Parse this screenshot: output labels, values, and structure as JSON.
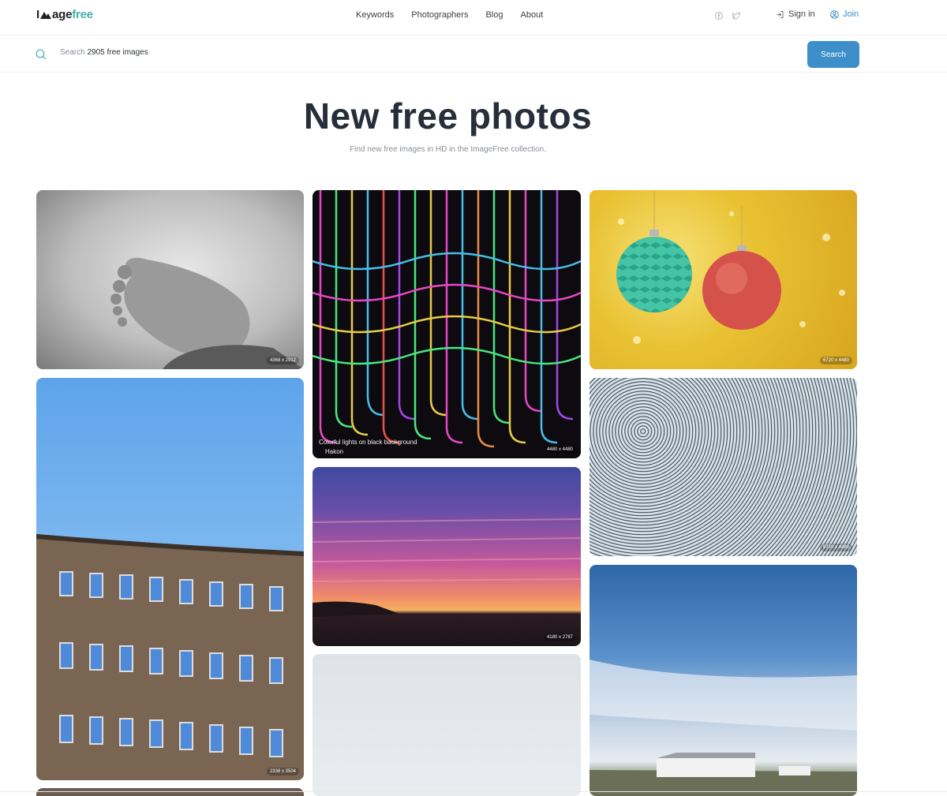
{
  "header": {
    "logo_prefix": "I",
    "logo_mid": "age",
    "logo_suffix": "free",
    "nav": [
      "Keywords",
      "Photographers",
      "Blog",
      "About"
    ],
    "signin_label": "Sign in",
    "join_label": "Join"
  },
  "search": {
    "prefix": "Search",
    "count_text": "2905 free images",
    "button_label": "Search"
  },
  "hero": {
    "title": "New free photos",
    "subtitle": "Find new free images in HD in the ImageFree collection."
  },
  "photos": [
    {
      "dims": "4368 x 2912"
    },
    {
      "dims": "4480 x 4480",
      "caption": "Colorful lights on black background",
      "author": "Hakon"
    },
    {
      "dims": "6720 x 4480"
    },
    {
      "dims": "2336 x 3504"
    },
    {
      "dims": "6720 x 4480"
    },
    {
      "dims": "4180 x 2787"
    }
  ],
  "colors": {
    "accent": "#3d8ec9",
    "brand_teal": "#3fb0ac",
    "heading": "#262e3a"
  },
  "icons": [
    "search-icon",
    "facebook-icon",
    "twitter-icon",
    "signin-icon",
    "user-icon",
    "mountain-logo-icon"
  ]
}
